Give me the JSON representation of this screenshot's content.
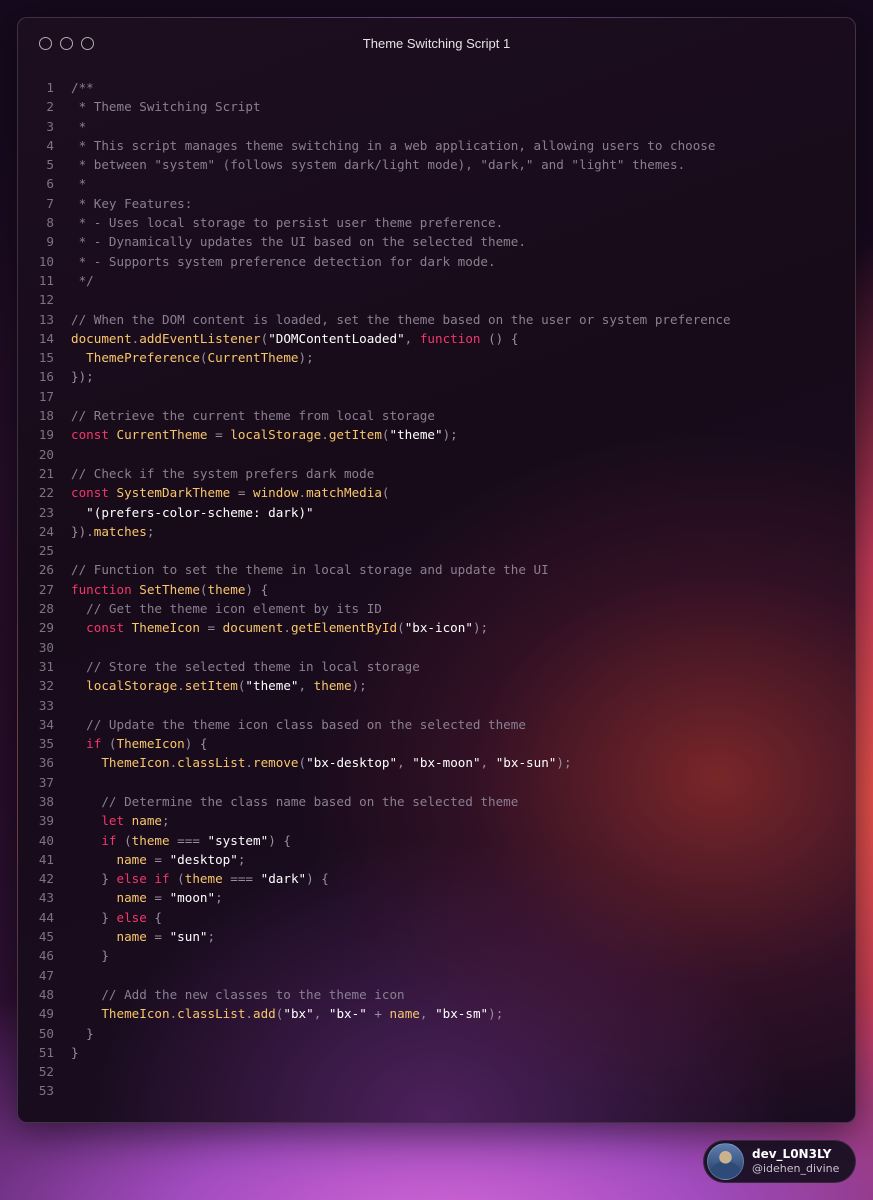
{
  "window": {
    "title": "Theme Switching Script 1"
  },
  "code": {
    "lines": [
      [
        [
          "c",
          "/**"
        ]
      ],
      [
        [
          "c",
          " * Theme Switching Script"
        ]
      ],
      [
        [
          "c",
          " *"
        ]
      ],
      [
        [
          "c",
          " * This script manages theme switching in a web application, allowing users to choose"
        ]
      ],
      [
        [
          "c",
          " * between \"system\" (follows system dark/light mode), \"dark,\" and \"light\" themes."
        ]
      ],
      [
        [
          "c",
          " *"
        ]
      ],
      [
        [
          "c",
          " * Key Features:"
        ]
      ],
      [
        [
          "c",
          " * - Uses local storage to persist user theme preference."
        ]
      ],
      [
        [
          "c",
          " * - Dynamically updates the UI based on the selected theme."
        ]
      ],
      [
        [
          "c",
          " * - Supports system preference detection for dark mode."
        ]
      ],
      [
        [
          "c",
          " */"
        ]
      ],
      [],
      [
        [
          "c",
          "// When the DOM content is loaded, set the theme based on the user or system preference"
        ]
      ],
      [
        [
          "f",
          "document"
        ],
        [
          "p",
          "."
        ],
        [
          "f",
          "addEventListener"
        ],
        [
          "p",
          "("
        ],
        [
          "s",
          "\"DOMContentLoaded\""
        ],
        [
          "p",
          ", "
        ],
        [
          "k",
          "function"
        ],
        [
          "p",
          " () {"
        ]
      ],
      [
        [
          "f",
          "  ThemePreference"
        ],
        [
          "p",
          "("
        ],
        [
          "f",
          "CurrentTheme"
        ],
        [
          "p",
          ");"
        ]
      ],
      [
        [
          "p",
          "});"
        ]
      ],
      [],
      [
        [
          "c",
          "// Retrieve the current theme from local storage"
        ]
      ],
      [
        [
          "k",
          "const "
        ],
        [
          "f",
          "CurrentTheme"
        ],
        [
          "p",
          " = "
        ],
        [
          "f",
          "localStorage"
        ],
        [
          "p",
          "."
        ],
        [
          "f",
          "getItem"
        ],
        [
          "p",
          "("
        ],
        [
          "s",
          "\"theme\""
        ],
        [
          "p",
          ");"
        ]
      ],
      [],
      [
        [
          "c",
          "// Check if the system prefers dark mode"
        ]
      ],
      [
        [
          "k",
          "const "
        ],
        [
          "f",
          "SystemDarkTheme"
        ],
        [
          "p",
          " = "
        ],
        [
          "f",
          "window"
        ],
        [
          "p",
          "."
        ],
        [
          "f",
          "matchMedia"
        ],
        [
          "p",
          "("
        ]
      ],
      [
        [
          "s",
          "  \"(prefers-color-scheme: dark)\""
        ]
      ],
      [
        [
          "p",
          "})."
        ],
        [
          "f",
          "matches"
        ],
        [
          "p",
          ";"
        ]
      ],
      [],
      [
        [
          "c",
          "// Function to set the theme in local storage and update the UI"
        ]
      ],
      [
        [
          "k",
          "function "
        ],
        [
          "f",
          "SetTheme"
        ],
        [
          "p",
          "("
        ],
        [
          "f",
          "theme"
        ],
        [
          "p",
          ") {"
        ]
      ],
      [
        [
          "c",
          "  // Get the theme icon element by its ID"
        ]
      ],
      [
        [
          "k",
          "  const "
        ],
        [
          "f",
          "ThemeIcon"
        ],
        [
          "p",
          " = "
        ],
        [
          "f",
          "document"
        ],
        [
          "p",
          "."
        ],
        [
          "f",
          "getElementById"
        ],
        [
          "p",
          "("
        ],
        [
          "s",
          "\"bx-icon\""
        ],
        [
          "p",
          ");"
        ]
      ],
      [],
      [
        [
          "c",
          "  // Store the selected theme in local storage"
        ]
      ],
      [
        [
          "f",
          "  localStorage"
        ],
        [
          "p",
          "."
        ],
        [
          "f",
          "setItem"
        ],
        [
          "p",
          "("
        ],
        [
          "s",
          "\"theme\""
        ],
        [
          "p",
          ", "
        ],
        [
          "f",
          "theme"
        ],
        [
          "p",
          ");"
        ]
      ],
      [],
      [
        [
          "c",
          "  // Update the theme icon class based on the selected theme"
        ]
      ],
      [
        [
          "k",
          "  if "
        ],
        [
          "p",
          "("
        ],
        [
          "f",
          "ThemeIcon"
        ],
        [
          "p",
          ") {"
        ]
      ],
      [
        [
          "f",
          "    ThemeIcon"
        ],
        [
          "p",
          "."
        ],
        [
          "f",
          "classList"
        ],
        [
          "p",
          "."
        ],
        [
          "f",
          "remove"
        ],
        [
          "p",
          "("
        ],
        [
          "s",
          "\"bx-desktop\""
        ],
        [
          "p",
          ", "
        ],
        [
          "s",
          "\"bx-moon\""
        ],
        [
          "p",
          ", "
        ],
        [
          "s",
          "\"bx-sun\""
        ],
        [
          "p",
          ");"
        ]
      ],
      [],
      [
        [
          "c",
          "    // Determine the class name based on the selected theme"
        ]
      ],
      [
        [
          "k",
          "    let "
        ],
        [
          "f",
          "name"
        ],
        [
          "p",
          ";"
        ]
      ],
      [
        [
          "k",
          "    if "
        ],
        [
          "p",
          "("
        ],
        [
          "f",
          "theme"
        ],
        [
          "p",
          " === "
        ],
        [
          "s",
          "\"system\""
        ],
        [
          "p",
          ") {"
        ]
      ],
      [
        [
          "f",
          "      name"
        ],
        [
          "p",
          " = "
        ],
        [
          "s",
          "\"desktop\""
        ],
        [
          "p",
          ";"
        ]
      ],
      [
        [
          "p",
          "    } "
        ],
        [
          "k",
          "else if "
        ],
        [
          "p",
          "("
        ],
        [
          "f",
          "theme"
        ],
        [
          "p",
          " === "
        ],
        [
          "s",
          "\"dark\""
        ],
        [
          "p",
          ") {"
        ]
      ],
      [
        [
          "f",
          "      name"
        ],
        [
          "p",
          " = "
        ],
        [
          "s",
          "\"moon\""
        ],
        [
          "p",
          ";"
        ]
      ],
      [
        [
          "p",
          "    } "
        ],
        [
          "k",
          "else "
        ],
        [
          "p",
          "{"
        ]
      ],
      [
        [
          "f",
          "      name"
        ],
        [
          "p",
          " = "
        ],
        [
          "s",
          "\"sun\""
        ],
        [
          "p",
          ";"
        ]
      ],
      [
        [
          "p",
          "    }"
        ]
      ],
      [],
      [
        [
          "c",
          "    // Add the new classes to the theme icon"
        ]
      ],
      [
        [
          "f",
          "    ThemeIcon"
        ],
        [
          "p",
          "."
        ],
        [
          "f",
          "classList"
        ],
        [
          "p",
          "."
        ],
        [
          "f",
          "add"
        ],
        [
          "p",
          "("
        ],
        [
          "s",
          "\"bx\""
        ],
        [
          "p",
          ", "
        ],
        [
          "s",
          "\"bx-\""
        ],
        [
          "p",
          " + "
        ],
        [
          "f",
          "name"
        ],
        [
          "p",
          ", "
        ],
        [
          "s",
          "\"bx-sm\""
        ],
        [
          "p",
          ");"
        ]
      ],
      [
        [
          "p",
          "  }"
        ]
      ],
      [
        [
          "p",
          "}"
        ]
      ],
      [],
      []
    ]
  },
  "author": {
    "display_name": "dev_L0N3LY",
    "handle": "@idehen_divine"
  }
}
